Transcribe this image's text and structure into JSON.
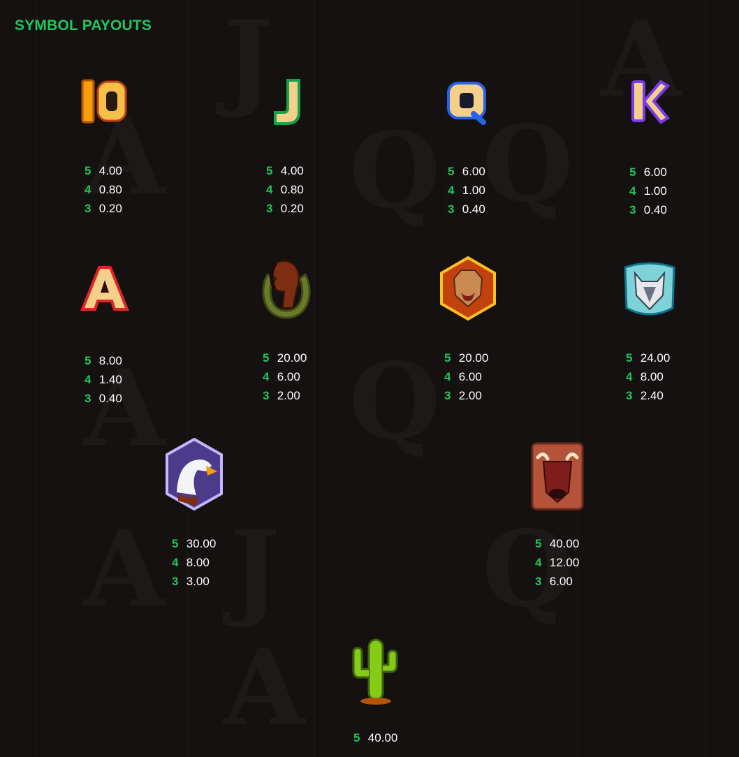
{
  "title": "SYMBOL PAYOUTS",
  "symbols": [
    {
      "name": "10",
      "icon": "ten-icon",
      "pays": [
        {
          "count": "5",
          "value": "4.00"
        },
        {
          "count": "4",
          "value": "0.80"
        },
        {
          "count": "3",
          "value": "0.20"
        }
      ]
    },
    {
      "name": "J",
      "icon": "jack-icon",
      "pays": [
        {
          "count": "5",
          "value": "4.00"
        },
        {
          "count": "4",
          "value": "0.80"
        },
        {
          "count": "3",
          "value": "0.20"
        }
      ]
    },
    {
      "name": "Q",
      "icon": "queen-icon",
      "pays": [
        {
          "count": "5",
          "value": "6.00"
        },
        {
          "count": "4",
          "value": "1.00"
        },
        {
          "count": "3",
          "value": "0.40"
        }
      ]
    },
    {
      "name": "K",
      "icon": "king-icon",
      "pays": [
        {
          "count": "5",
          "value": "6.00"
        },
        {
          "count": "4",
          "value": "1.00"
        },
        {
          "count": "3",
          "value": "0.40"
        }
      ]
    },
    {
      "name": "A",
      "icon": "ace-icon",
      "pays": [
        {
          "count": "5",
          "value": "8.00"
        },
        {
          "count": "4",
          "value": "1.40"
        },
        {
          "count": "3",
          "value": "0.40"
        }
      ]
    },
    {
      "name": "Horse",
      "icon": "horse-icon",
      "pays": [
        {
          "count": "5",
          "value": "20.00"
        },
        {
          "count": "4",
          "value": "6.00"
        },
        {
          "count": "3",
          "value": "2.00"
        }
      ]
    },
    {
      "name": "Cougar",
      "icon": "cougar-icon",
      "pays": [
        {
          "count": "5",
          "value": "20.00"
        },
        {
          "count": "4",
          "value": "6.00"
        },
        {
          "count": "3",
          "value": "2.00"
        }
      ]
    },
    {
      "name": "Wolf",
      "icon": "wolf-icon",
      "pays": [
        {
          "count": "5",
          "value": "24.00"
        },
        {
          "count": "4",
          "value": "8.00"
        },
        {
          "count": "3",
          "value": "2.40"
        }
      ]
    },
    {
      "name": "Eagle",
      "icon": "eagle-icon",
      "pays": [
        {
          "count": "5",
          "value": "30.00"
        },
        {
          "count": "4",
          "value": "8.00"
        },
        {
          "count": "3",
          "value": "3.00"
        }
      ]
    },
    {
      "name": "Bison",
      "icon": "bison-icon",
      "pays": [
        {
          "count": "5",
          "value": "40.00"
        },
        {
          "count": "4",
          "value": "12.00"
        },
        {
          "count": "3",
          "value": "6.00"
        }
      ]
    },
    {
      "name": "Cactus",
      "icon": "cactus-icon",
      "pays": [
        {
          "count": "5",
          "value": "40.00"
        }
      ]
    }
  ],
  "colors": {
    "accent": "#22c55e",
    "text": "#ffffff",
    "background": "#141110"
  }
}
